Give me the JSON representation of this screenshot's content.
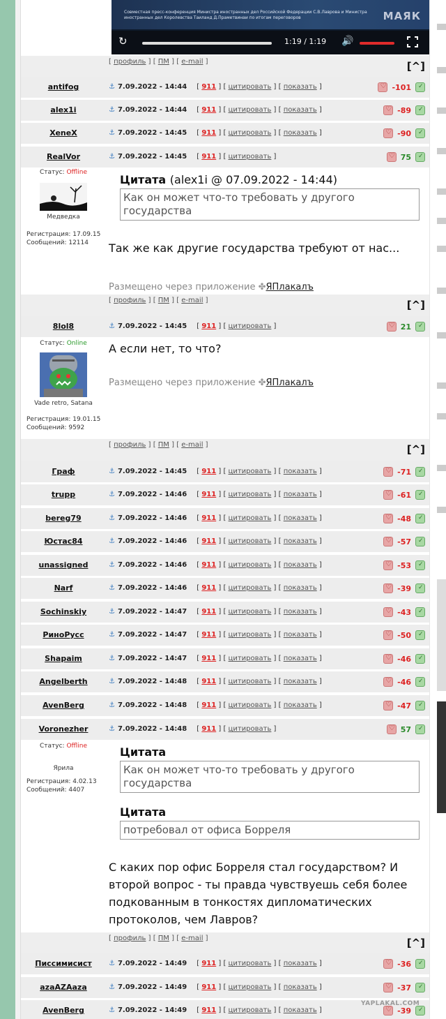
{
  "video": {
    "caption": "Совместная пресс-конференция Министра иностранных дел Российской Федерации С.В.Лаврова и Министра иностранных дел Королевства Таиланд Д.Праметвинаи по итогам переговоров",
    "logo": "МАЯК",
    "time": "1:19 / 1:19"
  },
  "links": {
    "profile": "профиль",
    "pm": "ПМ",
    "email": "e-mail",
    "up": "[^]"
  },
  "labels": {
    "cite": "цитировать",
    "show": "показать",
    "num911": "911",
    "status": "Статус:",
    "via": "Размещено через приложение",
    "app": "ЯПлакалъ"
  },
  "rows_top": [
    {
      "user": "antifog",
      "date": "7.09.2022 - 14:44",
      "score": "-101",
      "show": true
    },
    {
      "user": "alex1i",
      "date": "7.09.2022 - 14:44",
      "score": "-89",
      "show": true
    },
    {
      "user": "XeneX",
      "date": "7.09.2022 - 14:45",
      "score": "-90",
      "show": true
    }
  ],
  "post_realvor": {
    "user": "RealVor",
    "date": "7.09.2022 - 14:45",
    "score": "75",
    "status": "Offline",
    "title": "Медведка",
    "reg": "Регистрация: 17.09.15",
    "msgs": "Сообщений: 12114",
    "quote_label": "Цитата",
    "quote_meta": "(alex1i @ 07.09.2022 - 14:44)",
    "quote": "Как он может что-то требовать у другого государства",
    "text": "Так же как другие государства требуют от нас..."
  },
  "post_8lol8": {
    "user": "8lol8",
    "date": "7.09.2022 - 14:45",
    "score": "21",
    "status": "Online",
    "title": "Vade retro, Satana",
    "reg": "Регистрация: 19.01.15",
    "msgs": "Сообщений: 9592",
    "text": "А если нет, то что?"
  },
  "rows_mid": [
    {
      "user": "Граф",
      "date": "7.09.2022 - 14:45",
      "score": "-71"
    },
    {
      "user": "trupp",
      "date": "7.09.2022 - 14:46",
      "score": "-61"
    },
    {
      "user": "bereg79",
      "date": "7.09.2022 - 14:46",
      "score": "-48"
    },
    {
      "user": "Юстас84",
      "date": "7.09.2022 - 14:46",
      "score": "-57"
    },
    {
      "user": "unassigned",
      "date": "7.09.2022 - 14:46",
      "score": "-53"
    },
    {
      "user": "Narf",
      "date": "7.09.2022 - 14:46",
      "score": "-39"
    },
    {
      "user": "Sochinskiy",
      "date": "7.09.2022 - 14:47",
      "score": "-43"
    },
    {
      "user": "РиноРусс",
      "date": "7.09.2022 - 14:47",
      "score": "-50"
    },
    {
      "user": "Shapaim",
      "date": "7.09.2022 - 14:47",
      "score": "-46"
    },
    {
      "user": "Angelberth",
      "date": "7.09.2022 - 14:48",
      "score": "-46"
    },
    {
      "user": "AvenBerg",
      "date": "7.09.2022 - 14:48",
      "score": "-47"
    }
  ],
  "post_voronezher": {
    "user": "Voronezher",
    "date": "7.09.2022 - 14:48",
    "score": "57",
    "status": "Offline",
    "title": "Ярила",
    "reg": "Регистрация: 4.02.13",
    "msgs": "Сообщений: 4407",
    "quote_label": "Цитата",
    "quote1": "Как он может что-то требовать у другого государства",
    "quote2": "потребовал от офиса Борреля",
    "text": "С каких пор офис Борреля стал государством? И второй вопрос - ты правда чувствуешь себя более подкованным в тонкостях дипломатических протоколов, чем Лавров?"
  },
  "rows_bottom": [
    {
      "user": "Писсимисист",
      "date": "7.09.2022 - 14:49",
      "score": "-36"
    },
    {
      "user": "azaAZAaza",
      "date": "7.09.2022 - 14:49",
      "score": "-37"
    },
    {
      "user": "AvenBerg",
      "date": "7.09.2022 - 14:49",
      "score": "-39"
    }
  ],
  "watermark": "YAPLAKAL.COM",
  "colors": {
    "negative": "#dd2222",
    "positive": "#2a8a2a",
    "offline": "#dd2222",
    "online": "#2a9a2a",
    "sidebar": "#96c7ad"
  }
}
